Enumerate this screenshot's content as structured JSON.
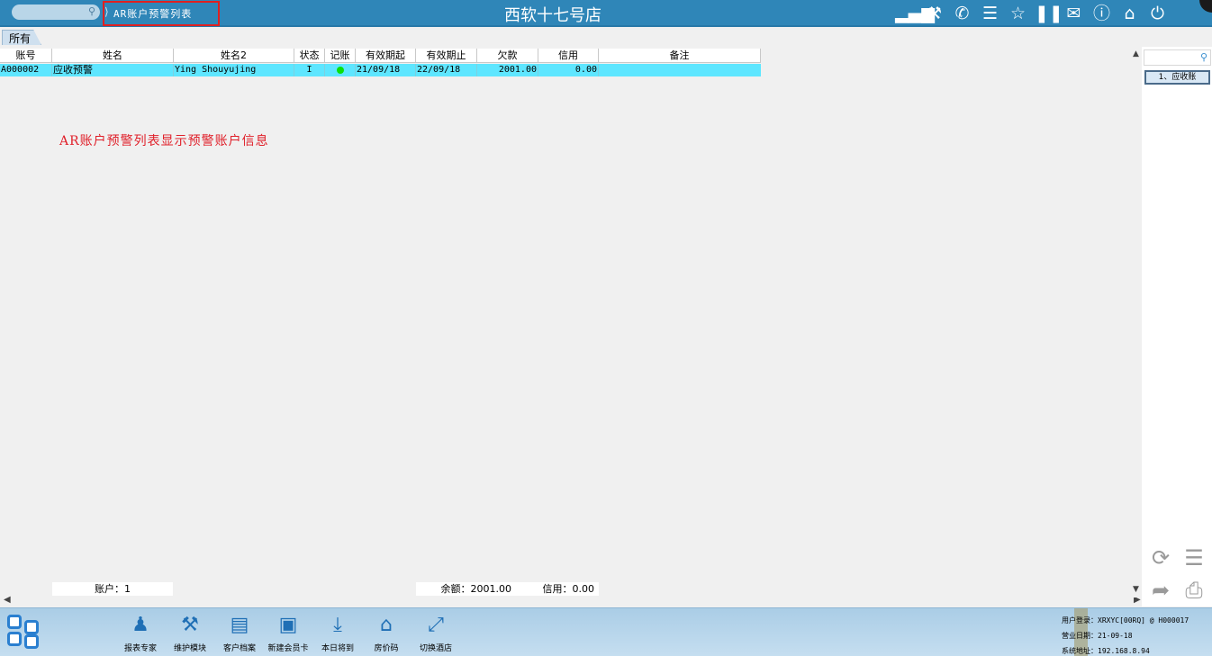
{
  "topbar": {
    "breadcrumb": "AR账户预警列表",
    "hotel_name": "西软十七号店",
    "icons": [
      "signal-icon",
      "tools-icon",
      "phone-icon",
      "menu-icon",
      "star-icon",
      "columns-icon",
      "mail-icon",
      "help-icon",
      "home-up-icon",
      "power-icon"
    ]
  },
  "tab": {
    "label": "所有"
  },
  "table": {
    "columns": [
      "账号",
      "姓名",
      "姓名2",
      "状态",
      "记账",
      "有效期起",
      "有效期止",
      "欠款",
      "信用",
      "备注"
    ],
    "rows": [
      {
        "account": "A000002",
        "name": "应收预警",
        "name2": "Ying Shouyujing",
        "status": "I",
        "posting": "green-dot",
        "valid_from": "21/09/18",
        "valid_to": "22/09/18",
        "debt": "2001.00",
        "credit": "0.00",
        "remark": ""
      }
    ]
  },
  "annotation": "AR账户预警列表显示预警账户信息",
  "summary": {
    "accounts": "账户：1",
    "balance": "余额：2001.00",
    "credit": "信用：0.00"
  },
  "right_panel": {
    "button_label": "1、应收账"
  },
  "dock": [
    {
      "label": "报表专家",
      "icon": "user-report-icon"
    },
    {
      "label": "维护模块",
      "icon": "tools-icon"
    },
    {
      "label": "客户档案",
      "icon": "profile-icon"
    },
    {
      "label": "新建会员卡",
      "icon": "card-icon"
    },
    {
      "label": "本日将到",
      "icon": "arrival-icon"
    },
    {
      "label": "房价码",
      "icon": "house-icon"
    },
    {
      "label": "切换酒店",
      "icon": "switch-icon"
    }
  ],
  "status": {
    "user": "用户登录：XRXYC[00RQ] @ H000017",
    "business_date": "营业日期：21-09-18",
    "system_address": "系统地址：192.168.8.94"
  },
  "colors": {
    "topbar": "#2f86b8",
    "selected_row": "#5ee6ff",
    "annotation": "#e0202a",
    "posting_dot": "#0be00b",
    "breadcrumb_highlight": "#e02020"
  }
}
